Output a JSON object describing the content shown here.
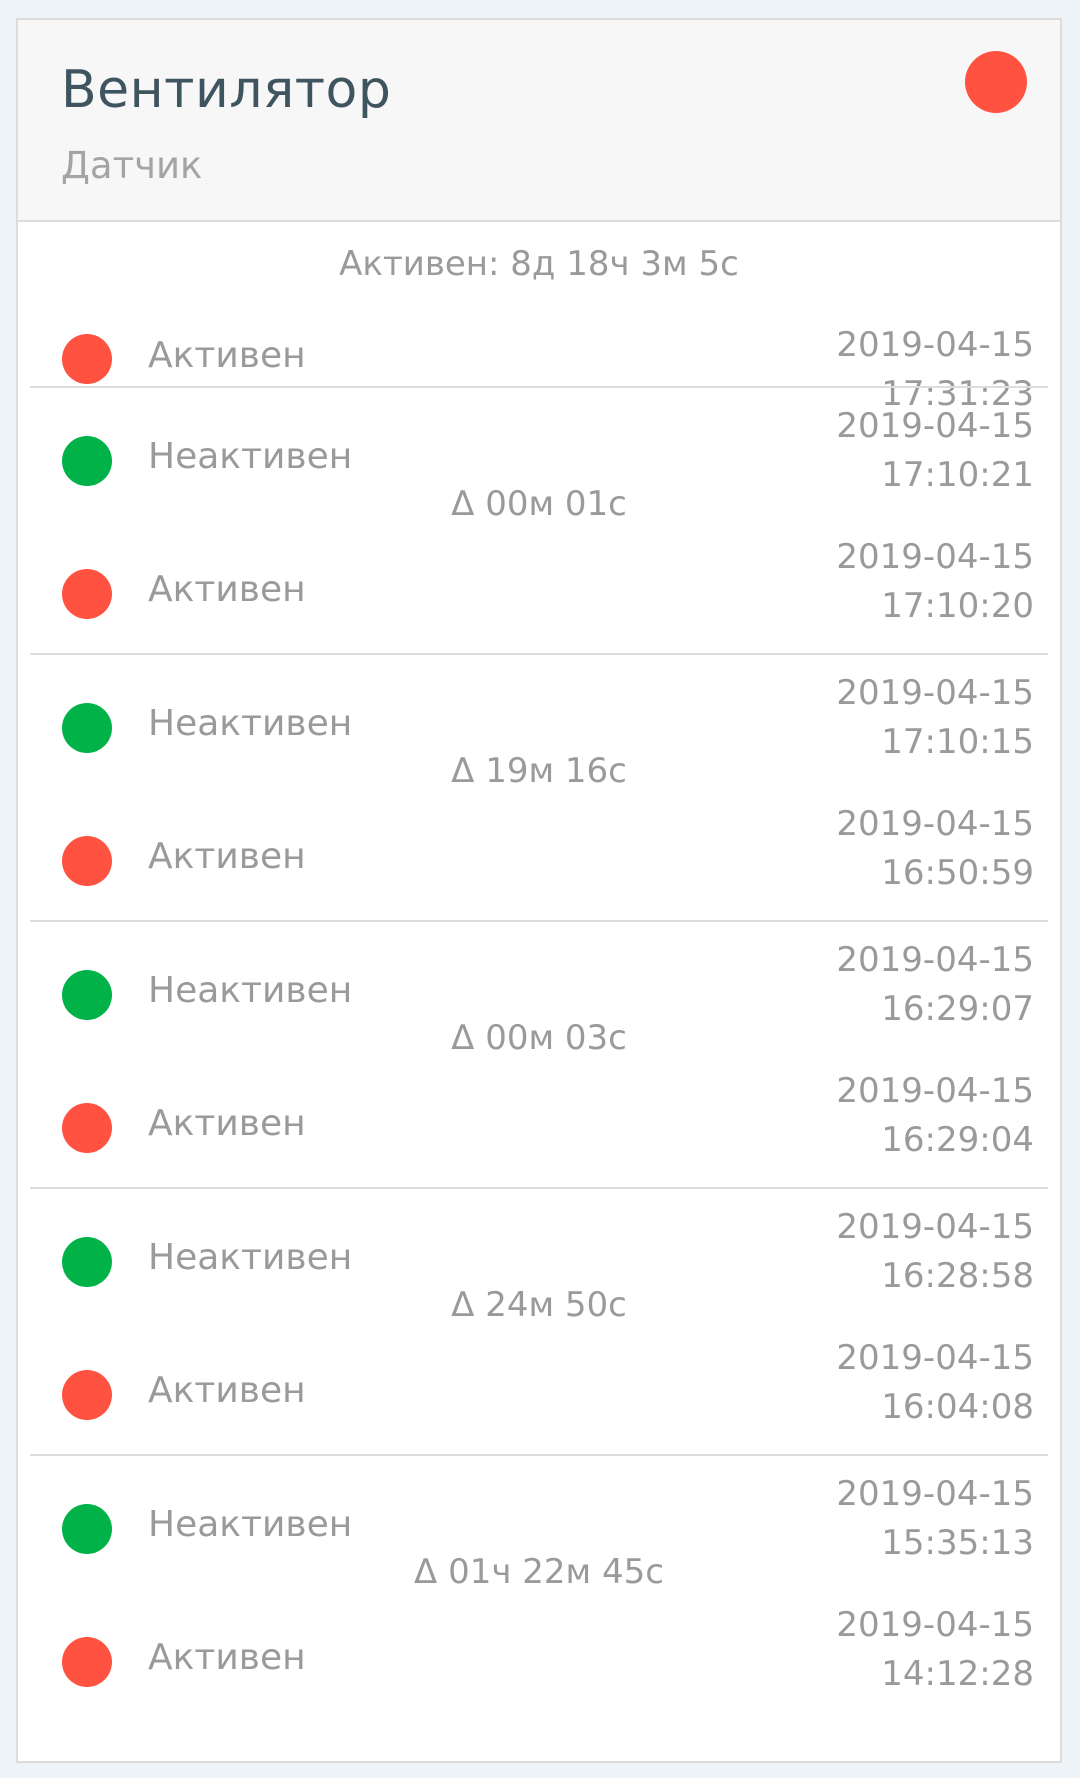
{
  "header": {
    "title": "Вентилятор",
    "subtitle": "Датчик",
    "status_color": "#ff5240"
  },
  "colors": {
    "active": "#ff5240",
    "inactive": "#00b248"
  },
  "current": {
    "duration": "Активен: 8д 18ч 3м 5с",
    "state": "Активен",
    "date": "2019-04-15",
    "time": "17:31:23"
  },
  "history": [
    {
      "top": {
        "state": "Неактивен",
        "date": "2019-04-15",
        "time": "17:10:21"
      },
      "duration": "Δ 00м 01с",
      "bottom": {
        "state": "Активен",
        "date": "2019-04-15",
        "time": "17:10:20"
      }
    },
    {
      "top": {
        "state": "Неактивен",
        "date": "2019-04-15",
        "time": "17:10:15"
      },
      "duration": "Δ 19м 16с",
      "bottom": {
        "state": "Активен",
        "date": "2019-04-15",
        "time": "16:50:59"
      }
    },
    {
      "top": {
        "state": "Неактивен",
        "date": "2019-04-15",
        "time": "16:29:07"
      },
      "duration": "Δ 00м 03с",
      "bottom": {
        "state": "Активен",
        "date": "2019-04-15",
        "time": "16:29:04"
      }
    },
    {
      "top": {
        "state": "Неактивен",
        "date": "2019-04-15",
        "time": "16:28:58"
      },
      "duration": "Δ 24м 50с",
      "bottom": {
        "state": "Активен",
        "date": "2019-04-15",
        "time": "16:04:08"
      }
    },
    {
      "top": {
        "state": "Неактивен",
        "date": "2019-04-15",
        "time": "15:35:13"
      },
      "duration": "Δ 01ч 22м 45с",
      "bottom": {
        "state": "Активен",
        "date": "2019-04-15",
        "time": "14:12:28"
      }
    }
  ]
}
